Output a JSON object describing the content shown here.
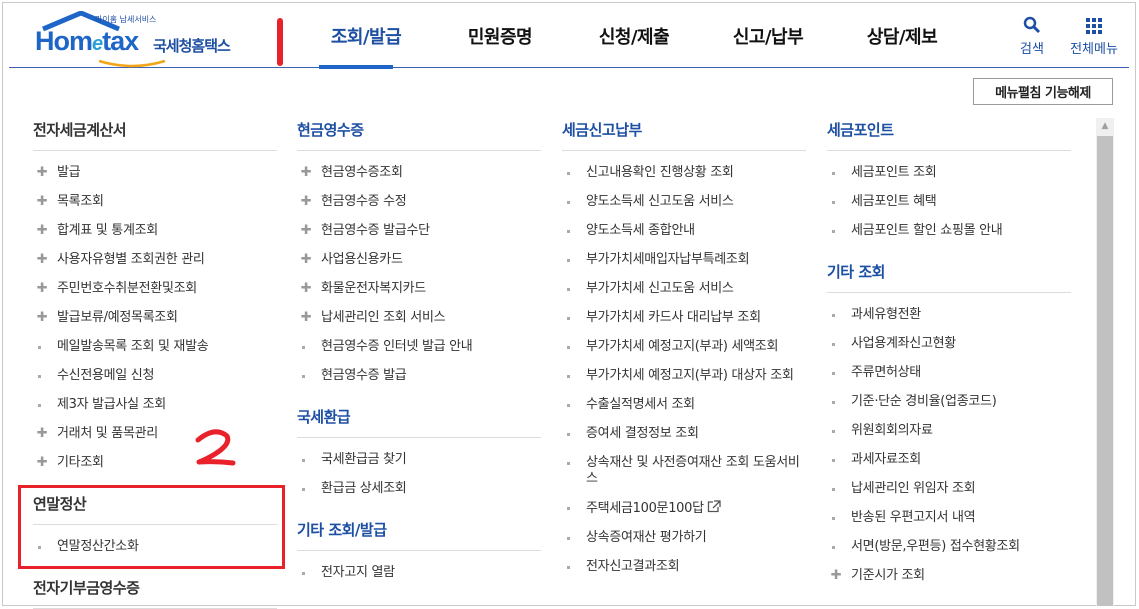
{
  "logo": {
    "small": "마이홈 납세서비스",
    "home": "Hom",
    "e": "e",
    "tax": "tax",
    "kor": "국세청홈택스"
  },
  "nav": [
    "조회/발급",
    "민원증명",
    "신청/제출",
    "신고/납부",
    "상담/제보"
  ],
  "tools": {
    "search": "검색",
    "menu": "전체메뉴"
  },
  "fold_button": "메뉴펼침 기능해제",
  "annotation": "2",
  "columns": [
    {
      "sections": [
        {
          "title": "전자세금계산서",
          "items": [
            {
              "label": "발급",
              "marker": "plus"
            },
            {
              "label": "목록조회",
              "marker": "plus"
            },
            {
              "label": "합계표 및 통계조회",
              "marker": "plus"
            },
            {
              "label": "사용자유형별 조회권한 관리",
              "marker": "plus"
            },
            {
              "label": "주민번호수취분전환및조회",
              "marker": "plus"
            },
            {
              "label": "발급보류/예정목록조회",
              "marker": "plus"
            },
            {
              "label": "메일발송목록 조회 및 재발송",
              "marker": "dot"
            },
            {
              "label": "수신전용메일 신청",
              "marker": "dot"
            },
            {
              "label": "제3자 발급사실 조회",
              "marker": "dot"
            },
            {
              "label": "거래처 및 품목관리",
              "marker": "plus"
            },
            {
              "label": "기타조회",
              "marker": "plus"
            }
          ]
        },
        {
          "title": "연말정산",
          "items": [
            {
              "label": "연말정산간소화",
              "marker": "dot"
            }
          ]
        },
        {
          "title": "전자기부금영수증",
          "items": []
        }
      ]
    },
    {
      "sections": [
        {
          "title": "현금영수증",
          "items": [
            {
              "label": "현금영수증조회",
              "marker": "plus"
            },
            {
              "label": "현금영수증 수정",
              "marker": "plus"
            },
            {
              "label": "현금영수증 발급수단",
              "marker": "plus"
            },
            {
              "label": "사업용신용카드",
              "marker": "plus"
            },
            {
              "label": "화물운전자복지카드",
              "marker": "plus"
            },
            {
              "label": "납세관리인 조회 서비스",
              "marker": "plus"
            },
            {
              "label": "현금영수증 인터넷 발급 안내",
              "marker": "dot"
            },
            {
              "label": "현금영수증 발급",
              "marker": "dot"
            }
          ]
        },
        {
          "title": "국세환급",
          "items": [
            {
              "label": "국세환급금 찾기",
              "marker": "dot"
            },
            {
              "label": "환급금 상세조회",
              "marker": "dot"
            }
          ]
        },
        {
          "title": "기타 조회/발급",
          "items": [
            {
              "label": "전자고지 열람",
              "marker": "dot"
            }
          ]
        }
      ]
    },
    {
      "sections": [
        {
          "title": "세금신고납부",
          "items": [
            {
              "label": "신고내용확인 진행상황 조회",
              "marker": "dot"
            },
            {
              "label": "양도소득세 신고도움 서비스",
              "marker": "dot"
            },
            {
              "label": "양도소득세 종합안내",
              "marker": "dot"
            },
            {
              "label": "부가가치세매입자납부특례조회",
              "marker": "dot"
            },
            {
              "label": "부가가치세 신고도움 서비스",
              "marker": "dot"
            },
            {
              "label": "부가가치세 카드사 대리납부 조회",
              "marker": "dot"
            },
            {
              "label": "부가가치세 예정고지(부과) 세액조회",
              "marker": "dot"
            },
            {
              "label": "부가가치세 예정고지(부과) 대상자 조회",
              "marker": "dot"
            },
            {
              "label": "수출실적명세서 조회",
              "marker": "dot"
            },
            {
              "label": "증여세 결정정보 조회",
              "marker": "dot"
            },
            {
              "label": "상속재산 및 사전증여재산 조회 도움서비스",
              "marker": "dot"
            },
            {
              "label": "주택세금100문100답",
              "marker": "dot",
              "external": true
            },
            {
              "label": "상속증여재산 평가하기",
              "marker": "dot"
            },
            {
              "label": "전자신고결과조회",
              "marker": "dot"
            }
          ]
        }
      ]
    },
    {
      "sections": [
        {
          "title": "세금포인트",
          "items": [
            {
              "label": "세금포인트 조회",
              "marker": "dot"
            },
            {
              "label": "세금포인트 혜택",
              "marker": "dot"
            },
            {
              "label": "세금포인트 할인 쇼핑몰 안내",
              "marker": "dot"
            }
          ]
        },
        {
          "title": "기타 조회",
          "items": [
            {
              "label": "과세유형전환",
              "marker": "dot"
            },
            {
              "label": "사업용계좌신고현황",
              "marker": "dot"
            },
            {
              "label": "주류면허상태",
              "marker": "dot"
            },
            {
              "label": "기준·단순 경비율(업종코드)",
              "marker": "dot"
            },
            {
              "label": "위원회회의자료",
              "marker": "dot"
            },
            {
              "label": "과세자료조회",
              "marker": "dot"
            },
            {
              "label": "납세관리인 위임자 조회",
              "marker": "dot"
            },
            {
              "label": "반송된 우편고지서 내역",
              "marker": "dot"
            },
            {
              "label": "서면(방문,우편등) 접수현황조회",
              "marker": "dot"
            },
            {
              "label": "기준시가 조회",
              "marker": "plus"
            }
          ]
        }
      ]
    }
  ]
}
